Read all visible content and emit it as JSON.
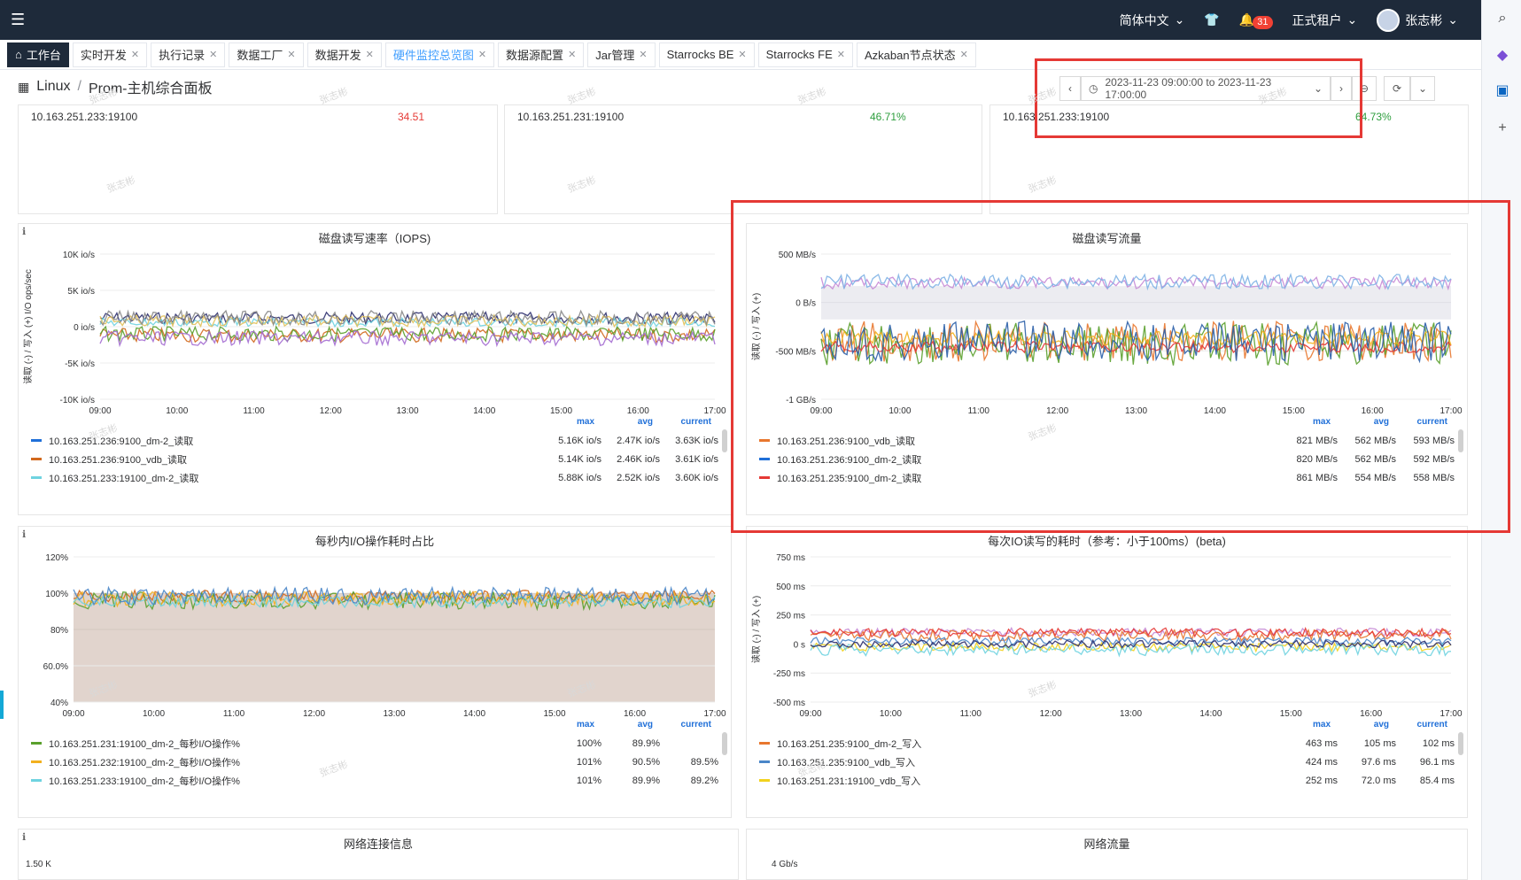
{
  "topbar": {
    "language": "简体中文",
    "notifications": "31",
    "tenant": "正式租户",
    "user": "张志彬"
  },
  "tabs": [
    {
      "label": "工作台"
    },
    {
      "label": "实时开发"
    },
    {
      "label": "执行记录"
    },
    {
      "label": "数据工厂"
    },
    {
      "label": "数据开发"
    },
    {
      "label": "硬件监控总览图"
    },
    {
      "label": "数据源配置"
    },
    {
      "label": "Jar管理"
    },
    {
      "label": "Starrocks BE"
    },
    {
      "label": "Starrocks FE"
    },
    {
      "label": "Azkaban节点状态"
    }
  ],
  "breadcrumb": {
    "root": "Linux",
    "page": "Prom-主机综合面板"
  },
  "time_range": "2023-11-23 09:00:00 to 2023-11-23 17:00:00",
  "stats": [
    {
      "ip": "10.163.251.233:19100",
      "value": "34.51",
      "color": "#e53935"
    },
    {
      "ip": "10.163.251.231:19100",
      "value": "46.71%",
      "color": "#2e9e3e"
    },
    {
      "ip": "10.163.251.233:19100",
      "value": "64.73%",
      "color": "#2e9e3e"
    }
  ],
  "legend_headers": {
    "max": "max",
    "avg": "avg",
    "current": "current"
  },
  "panels": {
    "iops": {
      "title": "磁盘读写速率（IOPS)",
      "ylabel": "读取 (-) / 写入 (+) I/O ops/sec",
      "yticks": [
        "10K io/s",
        "5K io/s",
        "0 io/s",
        "-5K io/s",
        "-10K io/s"
      ],
      "xticks": [
        "09:00",
        "10:00",
        "11:00",
        "12:00",
        "13:00",
        "14:00",
        "15:00",
        "16:00",
        "17:00"
      ],
      "legend": [
        {
          "name": "10.163.251.236:9100_dm-2_读取",
          "max": "5.16K io/s",
          "avg": "2.47K io/s",
          "current": "3.63K io/s",
          "color": "#1f6fd8"
        },
        {
          "name": "10.163.251.236:9100_vdb_读取",
          "max": "5.14K io/s",
          "avg": "2.46K io/s",
          "current": "3.61K io/s",
          "color": "#d2691e"
        },
        {
          "name": "10.163.251.233:19100_dm-2_读取",
          "max": "5.88K io/s",
          "avg": "2.52K io/s",
          "current": "3.60K io/s",
          "color": "#6fd3e0"
        }
      ]
    },
    "throughput": {
      "title": "磁盘读写流量",
      "ylabel": "读取 (-) / 写入 (+)",
      "yticks": [
        "500 MB/s",
        "0 B/s",
        "-500 MB/s",
        "-1 GB/s"
      ],
      "xticks": [
        "09:00",
        "10:00",
        "11:00",
        "12:00",
        "13:00",
        "14:00",
        "15:00",
        "16:00",
        "17:00"
      ],
      "legend": [
        {
          "name": "10.163.251.236:9100_vdb_读取",
          "max": "821 MB/s",
          "avg": "562 MB/s",
          "current": "593 MB/s",
          "color": "#e8772e"
        },
        {
          "name": "10.163.251.236:9100_dm-2_读取",
          "max": "820 MB/s",
          "avg": "562 MB/s",
          "current": "592 MB/s",
          "color": "#1f6fd8"
        },
        {
          "name": "10.163.251.235:9100_dm-2_读取",
          "max": "861 MB/s",
          "avg": "554 MB/s",
          "current": "558 MB/s",
          "color": "#e53935"
        }
      ]
    },
    "util": {
      "title": "每秒内I/O操作耗时占比",
      "yticks": [
        "120%",
        "100%",
        "80%",
        "60.0%",
        "40%"
      ],
      "xticks": [
        "09:00",
        "10:00",
        "11:00",
        "12:00",
        "13:00",
        "14:00",
        "15:00",
        "16:00",
        "17:00"
      ],
      "legend": [
        {
          "name": "10.163.251.231:19100_dm-2_每秒I/O操作%",
          "max": "100%",
          "avg": "89.9%",
          "current": "",
          "color": "#5aa02c"
        },
        {
          "name": "10.163.251.232:19100_dm-2_每秒I/O操作%",
          "max": "101%",
          "avg": "90.5%",
          "current": "89.5%",
          "color": "#f2b01e"
        },
        {
          "name": "10.163.251.233:19100_dm-2_每秒I/O操作%",
          "max": "101%",
          "avg": "89.9%",
          "current": "89.2%",
          "color": "#6fd3e0"
        }
      ]
    },
    "latency": {
      "title": "每次IO读写的耗时（参考：小于100ms）(beta)",
      "ylabel": "读取 (-) / 写入 (+)",
      "yticks": [
        "750 ms",
        "500 ms",
        "250 ms",
        "0 s",
        "-250 ms",
        "-500 ms"
      ],
      "xticks": [
        "09:00",
        "10:00",
        "11:00",
        "12:00",
        "13:00",
        "14:00",
        "15:00",
        "16:00",
        "17:00"
      ],
      "legend": [
        {
          "name": "10.163.251.235:9100_dm-2_写入",
          "max": "463 ms",
          "avg": "105 ms",
          "current": "102 ms",
          "color": "#e8772e"
        },
        {
          "name": "10.163.251.235:9100_vdb_写入",
          "max": "424 ms",
          "avg": "97.6 ms",
          "current": "96.1 ms",
          "color": "#4a86c8"
        },
        {
          "name": "10.163.251.231:19100_vdb_写入",
          "max": "252 ms",
          "avg": "72.0 ms",
          "current": "85.4 ms",
          "color": "#f2d21e"
        }
      ]
    },
    "netconn": {
      "title": "网络连接信息",
      "ytick": "1.50 K"
    },
    "netflow": {
      "title": "网络流量",
      "ytick": "4 Gb/s"
    }
  },
  "watermark": "张志彬"
}
